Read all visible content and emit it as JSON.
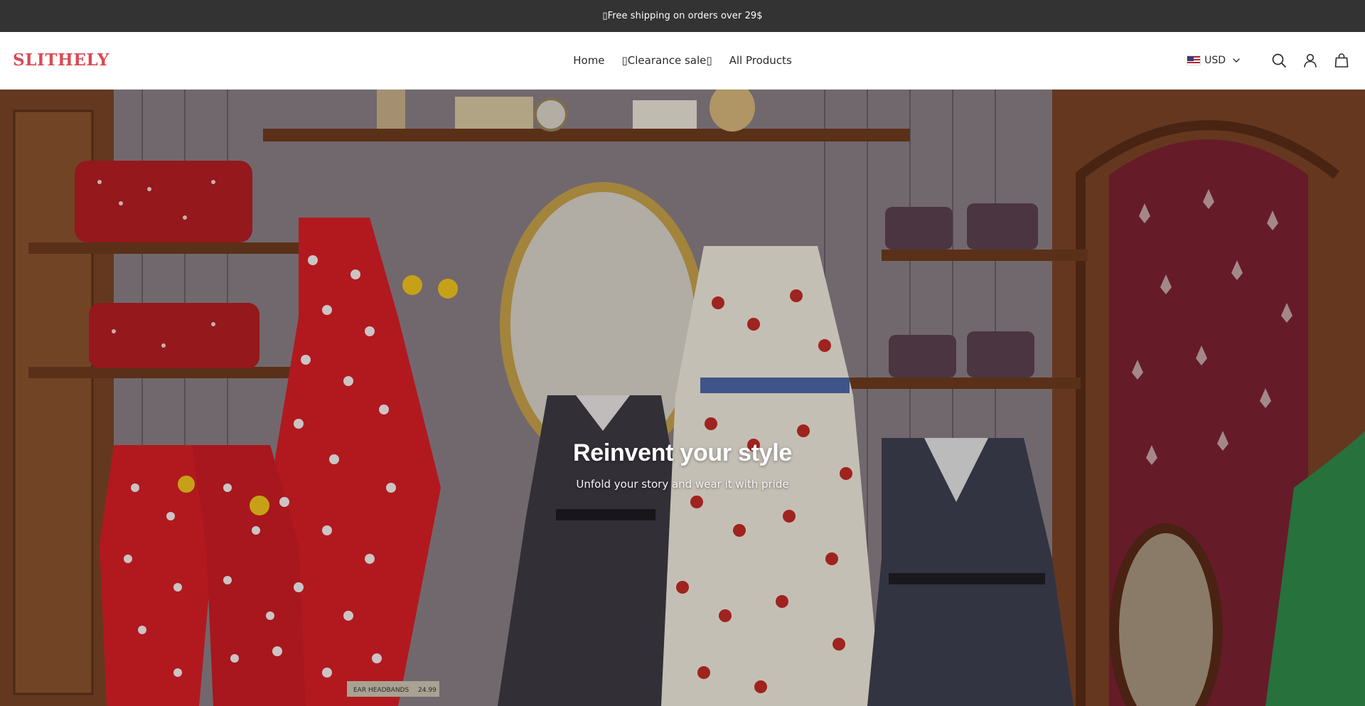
{
  "announcement": {
    "glyph": "▯",
    "text": "Free shipping on orders over 29$"
  },
  "header": {
    "logo": "SLITHELY",
    "nav": [
      {
        "label": "Home"
      },
      {
        "label": "▯Clearance sale▯"
      },
      {
        "label": "All Products"
      }
    ],
    "currency": {
      "code": "USD",
      "flag": "us-flag-icon"
    },
    "icons": [
      "search-icon",
      "account-icon",
      "cart-icon"
    ]
  },
  "hero": {
    "title": "Reinvent your style",
    "subtitle": "Unfold your story and wear it with pride",
    "sign_text": "EAR HEADBANDS",
    "sign_price": "24.99"
  },
  "colors": {
    "announcement_bg": "#333333",
    "logo": "#d94a54",
    "header_bg": "#ffffff"
  }
}
